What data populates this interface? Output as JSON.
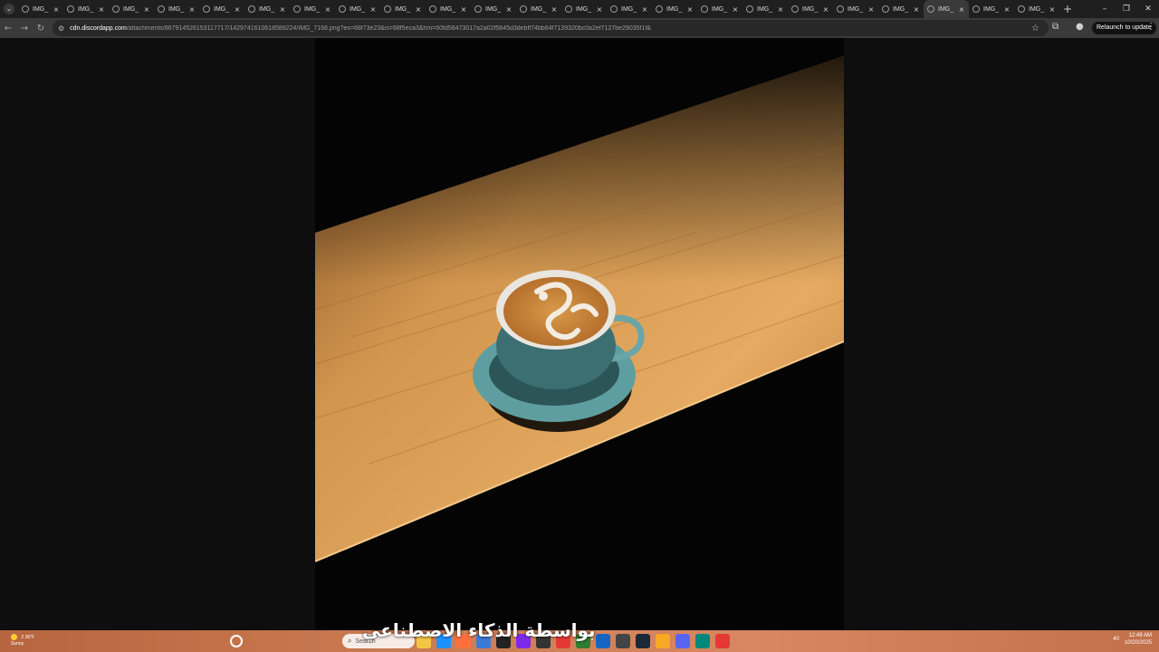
{
  "browser": {
    "tabs": [
      {
        "label": "IMG_"
      },
      {
        "label": "IMG_"
      },
      {
        "label": "IMG_"
      },
      {
        "label": "IMG_"
      },
      {
        "label": "IMG_"
      },
      {
        "label": "IMG_"
      },
      {
        "label": "IMG_"
      },
      {
        "label": "IMG_"
      },
      {
        "label": "IMG_"
      },
      {
        "label": "IMG_"
      },
      {
        "label": "IMG_"
      },
      {
        "label": "IMG_"
      },
      {
        "label": "IMG_"
      },
      {
        "label": "IMG_"
      },
      {
        "label": "IMG_"
      },
      {
        "label": "IMG_"
      },
      {
        "label": "IMG_"
      },
      {
        "label": "IMG_"
      },
      {
        "label": "IMG_"
      },
      {
        "label": "IMG_"
      },
      {
        "label": "IMG_",
        "active": true
      },
      {
        "label": "IMG_"
      },
      {
        "label": "IMG_"
      }
    ],
    "url_host": "cdn.discordapp.com",
    "url_path": "/attachments/867914526153117717/1429741610618589224/IMG_7168.png?ex=68f73e23&is=68f5eca3&hm=60fd58473017a2a02f5845d3debff74bb64f7139320bc0a2ef7127be29035f1f&",
    "relaunch_label": "Relaunch to update"
  },
  "taskbar": {
    "weather_temp": "36°F",
    "weather_desc": "Sunny",
    "weather_badge": "2",
    "search_placeholder": "Search",
    "overlay_caption": "بواسطة الذكاء الاصطناعي",
    "clock_time": "12:49 AM",
    "clock_date": "10/20/2025",
    "tray_count": "40"
  },
  "colors": {
    "accent": "#3a3a3a",
    "page_bg": "#0e0e0e",
    "taskbar": "#cb7b52"
  }
}
